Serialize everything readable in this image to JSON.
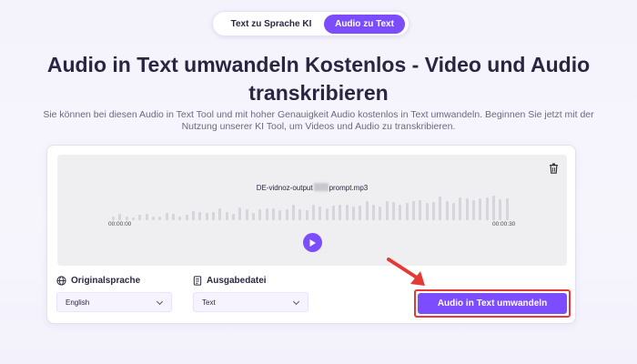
{
  "tabs": [
    {
      "label": "Text zu Sprache KI",
      "active": false
    },
    {
      "label": "Audio zu Text",
      "active": true
    }
  ],
  "hero": {
    "title": "Audio in Text umwandeln Kostenlos - Video und Audio transkribieren",
    "subtitle": "Sie können bei diesen Audio in Text Tool und mit hoher Genauigkeit Audio kostenlos in Text umwandeln. Beginnen Sie jetzt mit der Nutzung unserer KI Tool, um Videos und Audio zu transkribieren."
  },
  "player": {
    "file_prefix": "DE-vidnoz-output",
    "file_suffix": "prompt.mp3",
    "time_start": "00:00:00",
    "time_end": "00:00:30",
    "icons": {
      "delete": "trash-icon",
      "play": "play-icon"
    }
  },
  "options": {
    "lang_label": "Originalsprache",
    "lang_value": "English",
    "lang_icon": "globe-icon",
    "out_label": "Ausgabedatei",
    "out_value": "Text",
    "out_icon": "file-icon"
  },
  "action": {
    "convert_label": "Audio in Text umwandeln"
  },
  "colors": {
    "accent": "#7c4dff",
    "highlight": "#e53935",
    "background": "#f4f2fb"
  }
}
